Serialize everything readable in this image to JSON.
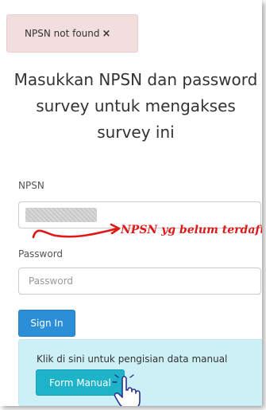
{
  "alert": {
    "message": "NPSN not found",
    "close_icon": "×",
    "bg_color": "#f2dede"
  },
  "heading": "Masukkan NPSN dan password survey untuk mengakses survey ini",
  "form": {
    "npsn_label": "NPSN",
    "npsn_value": "",
    "password_label": "Password",
    "password_placeholder": "Password",
    "sign_in_label": "Sign In"
  },
  "manual": {
    "text": "Klik di sini untuk pengisian data manual",
    "button_label": "Form Manual"
  },
  "annotation": {
    "text": "NPSN yg belum terdaftar",
    "color": "#e01818"
  },
  "colors": {
    "primary": "#2b8fd8",
    "info_button": "#1fb3c9",
    "info_bg": "#cdeff6"
  }
}
